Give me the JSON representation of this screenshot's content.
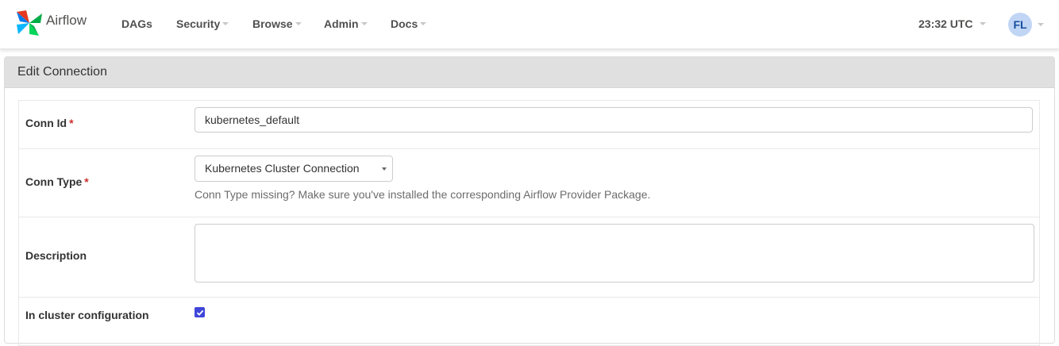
{
  "navbar": {
    "brand": "Airflow",
    "items": [
      {
        "label": "DAGs",
        "dropdown": false
      },
      {
        "label": "Security",
        "dropdown": true
      },
      {
        "label": "Browse",
        "dropdown": true
      },
      {
        "label": "Admin",
        "dropdown": true
      },
      {
        "label": "Docs",
        "dropdown": true
      }
    ],
    "clock": "23:32 UTC",
    "user_initials": "FL"
  },
  "panel": {
    "title": "Edit Connection"
  },
  "form": {
    "conn_id": {
      "label": "Conn Id",
      "required_mark": "*",
      "value": "kubernetes_default"
    },
    "conn_type": {
      "label": "Conn Type",
      "required_mark": "*",
      "selected": "Kubernetes Cluster Connection",
      "help": "Conn Type missing? Make sure you've installed the corresponding Airflow Provider Package."
    },
    "description": {
      "label": "Description",
      "value": ""
    },
    "in_cluster": {
      "label": "In cluster configuration",
      "checked": true
    }
  },
  "colors": {
    "accent": "#3f46d8",
    "required": "#c9302c",
    "panel_heading_bg": "#e0e0e0",
    "avatar_bg": "#c1d5f5",
    "avatar_text": "#194f9e"
  }
}
